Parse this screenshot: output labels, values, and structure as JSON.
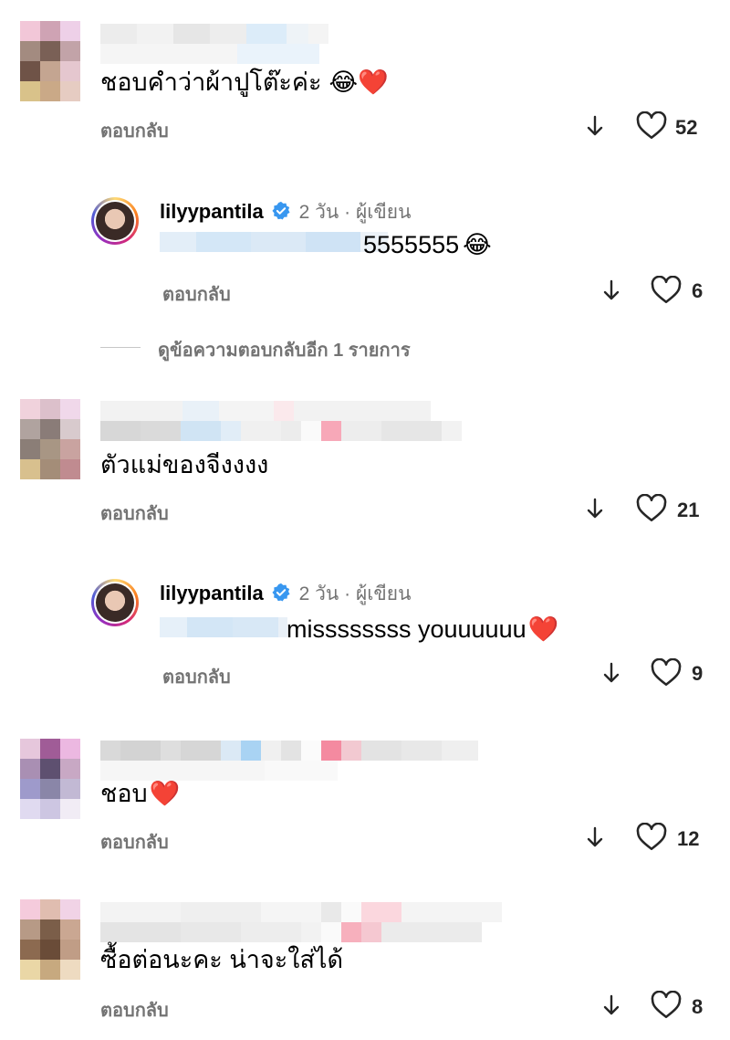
{
  "colors": {
    "muted": "#737373",
    "verified": "#3897f0",
    "heart": "#e0245e"
  },
  "comments": [
    {
      "text": "ชอบคำว่าผ้าปูโต๊ะค่ะ",
      "emojis": "😂❤️",
      "reply_label": "ตอบกลับ",
      "likes": "52",
      "sort_icon": "arrow-down-icon",
      "like_icon": "heart-outline-icon"
    },
    {
      "text": "ตัวแม่ของจีงงงง",
      "reply_label": "ตอบกลับ",
      "likes": "21",
      "sort_icon": "arrow-down-icon",
      "like_icon": "heart-outline-icon"
    },
    {
      "text": "ชอบ",
      "emojis": "❤️",
      "reply_label": "ตอบกลับ",
      "likes": "12",
      "sort_icon": "arrow-down-icon",
      "like_icon": "heart-outline-icon"
    },
    {
      "text": "ซื้อต่อนะคะ น่าจะใส่ได้",
      "reply_label": "ตอบกลับ",
      "likes": "8",
      "sort_icon": "arrow-down-icon",
      "like_icon": "heart-outline-icon"
    }
  ],
  "replies": [
    {
      "username": "lilyypantila",
      "verified_icon": "verified-badge-icon",
      "meta": "2 วัน · ผู้เขียน",
      "text": "5555555",
      "emojis": "😂",
      "reply_label": "ตอบกลับ",
      "likes": "6"
    },
    {
      "username": "lilyypantila",
      "verified_icon": "verified-badge-icon",
      "meta": "2 วัน · ผู้เขียน",
      "text": "missssssss youuuuuu",
      "emojis": "❤️",
      "reply_label": "ตอบกลับ",
      "likes": "9"
    }
  ],
  "view_more": "ดูข้อความตอบกลับอีก 1 รายการ"
}
